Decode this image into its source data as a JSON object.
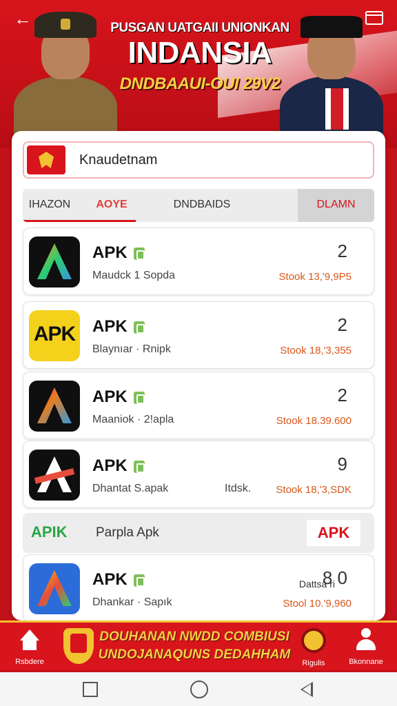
{
  "header": {
    "title_line1": "PUSGAN UATGAII UNIONKAN",
    "title_line2": "INDANSIA",
    "title_line3": "DNDBAAUI-OUI 29V2"
  },
  "search": {
    "value": "Knaudetnam"
  },
  "tabs": [
    {
      "label": "IHAZON"
    },
    {
      "label": "AOYE"
    },
    {
      "label": "DNDBAIDS"
    },
    {
      "label": "DLAMN"
    }
  ],
  "apps": [
    {
      "title": "APK",
      "subtitle": "Maudck 1 Sopda",
      "count": "2",
      "stock": "Stook 13,'9,9P5",
      "icon": "colorful-a-icon"
    },
    {
      "title": "APK",
      "subtitle": "Blaynıar · Rnipk",
      "count": "2",
      "stock": "Stook 18,'3,355",
      "icon": "apk-text-icon",
      "icon_text": "APK"
    },
    {
      "title": "APK",
      "subtitle": "Maaniok · 2!apla",
      "count": "2",
      "stock": "Stook 18.39.600",
      "icon": "colorful-a-icon"
    },
    {
      "title": "APK",
      "subtitle": "Dhantat S.apak",
      "extra": "Itdsk.",
      "count": "9",
      "stock": "Stook 18,'3,SDK",
      "icon": "white-a-icon"
    },
    {
      "title": "APK",
      "subtitle": "Dhankar · Sapık",
      "count": "8 0",
      "count_label": "Dattsa ri",
      "stock": "Stool 10.'9,960",
      "icon": "colorful-a-icon"
    }
  ],
  "promo": {
    "left": "APIK",
    "middle": "Parpla Apk",
    "right": "APK"
  },
  "bottom_banner": {
    "line1": "DOUHANAN NWDD COMBIUSI",
    "line2": "UNDOJANAQUNS DEDAHHAM"
  },
  "bottom_nav": [
    {
      "label": "Rsbdere",
      "icon": "home-icon"
    },
    {
      "label": "Rigulis",
      "icon": "medal-icon"
    },
    {
      "label": "Bkonnane",
      "icon": "person-icon"
    }
  ],
  "colors": {
    "primary": "#d8141c",
    "accent": "#f6d043",
    "stock": "#d9561a",
    "green": "#27a644"
  }
}
